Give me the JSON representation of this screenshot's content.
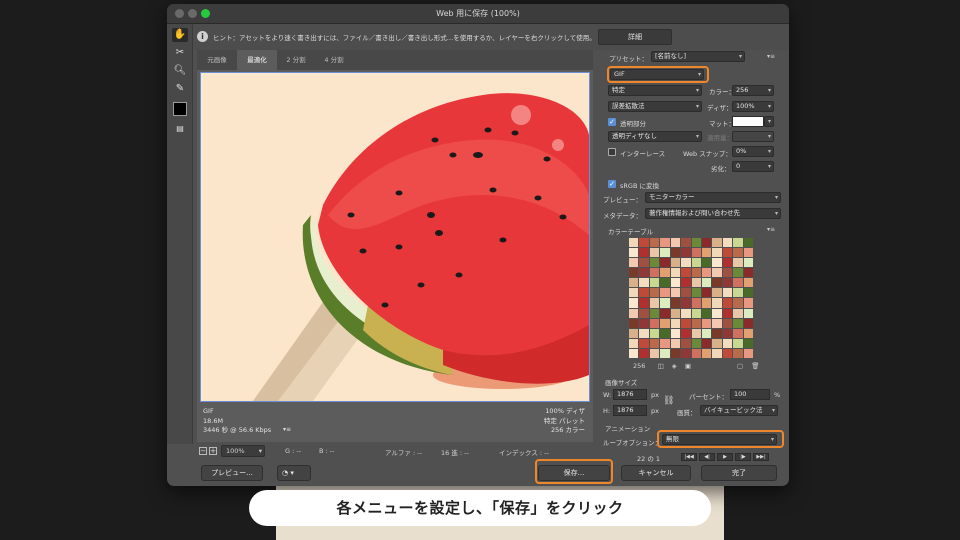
{
  "window": {
    "title": "Web 用に保存 (100%)"
  },
  "hint": {
    "text": "ヒント：アセットをより速く書き出すには、ファイル／書き出し／書き出し形式…を使用するか、レイヤーを右クリックして使用。",
    "detail_button": "詳細"
  },
  "tabs": [
    "元画像",
    "最適化",
    "2 分割",
    "4 分割"
  ],
  "preview": {
    "status_left": [
      "GIF",
      "18.6M",
      "3446 秒 @ 56.6 Kbps"
    ],
    "status_right": [
      "100% ディザ",
      "特定 パレット",
      "256 カラー"
    ]
  },
  "infobar": {
    "zoom": "100%",
    "g": "G : --",
    "b": "B : --",
    "alpha": "アルファ : --",
    "hex": "16 進 : --",
    "index": "インデックス : --"
  },
  "footer": {
    "preview_button": "プレビュー...",
    "save_button": "保存...",
    "cancel_button": "キャンセル",
    "done_button": "完了"
  },
  "settings": {
    "preset_label": "プリセット：",
    "preset_value": "[名前なし]",
    "format": "GIF",
    "reduction": "特定",
    "colors_label": "カラー：",
    "colors_value": "256",
    "dither_algo": "誤差拡散法",
    "dither_label": "ディザ：",
    "dither_value": "100%",
    "transparency_label": "透明部分",
    "matte_label": "マット：",
    "transparency_dither": "透明ディザなし",
    "amount_label": "適用量：",
    "interlaced_label": "インターレース",
    "web_snap_label": "Web スナップ：",
    "web_snap_value": "0%",
    "lossy_label": "劣化：",
    "lossy_value": "0",
    "srgb_label": "sRGB に変換",
    "preview_label": "プレビュー：",
    "preview_value": "モニターカラー",
    "metadata_label": "メタデータ：",
    "metadata_value": "著作権情報および問い合わせ先",
    "color_table_label": "カラーテーブル",
    "color_count": "256"
  },
  "image_size": {
    "label": "画像サイズ",
    "w_label": "W:",
    "w_value": "1876",
    "h_label": "H:",
    "h_value": "1876",
    "unit": "px",
    "percent_label": "パーセント：",
    "percent_value": "100",
    "percent_unit": "%",
    "quality_label": "画質：",
    "quality_value": "バイキュービック法"
  },
  "animation": {
    "label": "アニメーション",
    "loop_label": "ループオプション：",
    "loop_value": "無限",
    "frame_counter": "22 の 1"
  },
  "caption": {
    "text": "各メニューを設定し、「保存」をクリック"
  },
  "colors": {
    "highlight": "#f0862a",
    "accent_check": "#5a8fd6"
  }
}
